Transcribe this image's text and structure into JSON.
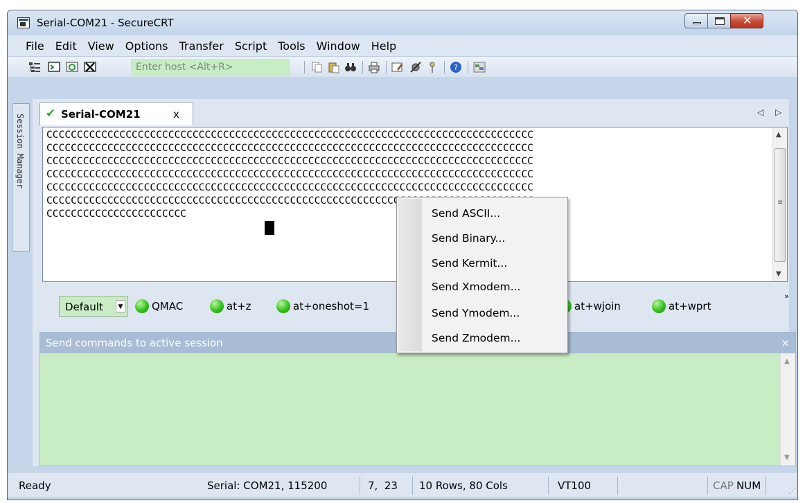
{
  "window": {
    "title": "Serial-COM21 - SecureCRT"
  },
  "menu": [
    "File",
    "Edit",
    "View",
    "Options",
    "Transfer",
    "Script",
    "Tools",
    "Window",
    "Help"
  ],
  "toolbar": {
    "host_placeholder": "Enter host <Alt+R>"
  },
  "side_panel": {
    "label": "Session Manager"
  },
  "tab": {
    "label": "Serial-COM21",
    "close": "x",
    "nav_left": "◁",
    "nav_right": "▷"
  },
  "terminal": {
    "lines": [
      "CCCCCCCCCCCCCCCCCCCCCCCCCCCCCCCCCCCCCCCCCCCCCCCCCCCCCCCCCCCCCCCCCCCCCCCCCCCCCCCC",
      "CCCCCCCCCCCCCCCCCCCCCCCCCCCCCCCCCCCCCCCCCCCCCCCCCCCCCCCCCCCCCCCCCCCCCCCCCCCCCCCC",
      "CCCCCCCCCCCCCCCCCCCCCCCCCCCCCCCCCCCCCCCCCCCCCCCCCCCCCCCCCCCCCCCCCCCCCCCCCCCCCCCC",
      "CCCCCCCCCCCCCCCCCCCCCCCCCCCCCCCCCCCCCCCCCCCCCCCCCCCCCCCCCCCCCCCCCCCCCCCCCCCCCCCC",
      "CCCCCCCCCCCCCCCCCCCCCCCCCCCCCCCCCCCCCCCCCCCCCCCCCCCCCCCCCCCCCCCCCCCCCCCCCCCCCCCC",
      "CCCCCCCCCCCCCCCCCCCCCCCCCCCCCCCCCCCCCCCCCCCCCCCCCCCCCCCCCCCCCCCCCCCCCCCCCCCCCCCC",
      "CCCCCCCCCCCCCCCCCCCCCCC"
    ]
  },
  "button_bar": {
    "selector": "Default",
    "buttons": [
      "QMAC",
      "at+z",
      "at+oneshot=1",
      "at+wjoin",
      "at+wprt"
    ]
  },
  "command_window": {
    "title": "Send commands to active session",
    "close": "×"
  },
  "status": {
    "ready": "Ready",
    "connection": "Serial: COM21, 115200",
    "cursor": "7,  23",
    "size": "10 Rows, 80 Cols",
    "emulation": "VT100",
    "cap": "CAP",
    "num": "NUM"
  },
  "context_menu": [
    "Send ASCII...",
    "Send Binary...",
    "Send Kermit...",
    "Send Xmodem...",
    "Send Ymodem...",
    "Send Zmodem..."
  ]
}
